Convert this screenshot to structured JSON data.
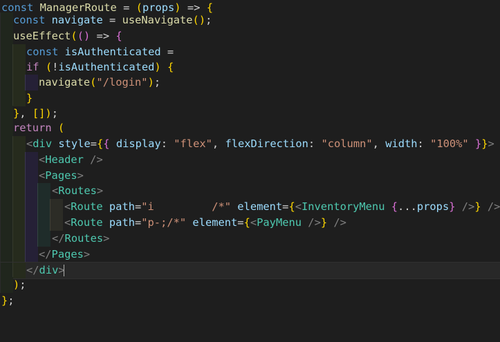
{
  "editor": {
    "lines": [
      {
        "indent": 0,
        "text": "const ManagerRoute = (props) => {"
      },
      {
        "indent": 1,
        "text": "const navigate = useNavigate();"
      },
      {
        "indent": 1,
        "text": "useEffect(() => {"
      },
      {
        "indent": 2,
        "text": "const isAuthenticated ="
      },
      {
        "indent": 2,
        "text": "if (!isAuthenticated) {"
      },
      {
        "indent": 3,
        "text": "navigate(\"/login\");"
      },
      {
        "indent": 2,
        "text": "}"
      },
      {
        "indent": 1,
        "text": "}, []);"
      },
      {
        "indent": 1,
        "text": "return ("
      },
      {
        "indent": 2,
        "text": "<div style={{ display: \"flex\", flexDirection: \"column\", width: \"100%\" }}>"
      },
      {
        "indent": 3,
        "text": "<Header />"
      },
      {
        "indent": 3,
        "text": "<Pages>"
      },
      {
        "indent": 4,
        "text": "<Routes>"
      },
      {
        "indent": 5,
        "text": "<Route path=\"i         /*\" element={<InventoryMenu {...props} />} />"
      },
      {
        "indent": 5,
        "text": "<Route path=\"p-;/*\" element={<PayMenu />} />"
      },
      {
        "indent": 4,
        "text": "</Routes>"
      },
      {
        "indent": 3,
        "text": "</Pages>"
      },
      {
        "indent": 2,
        "text": "</div>"
      },
      {
        "indent": 1,
        "text": ");"
      },
      {
        "indent": 0,
        "text": "};"
      }
    ]
  }
}
